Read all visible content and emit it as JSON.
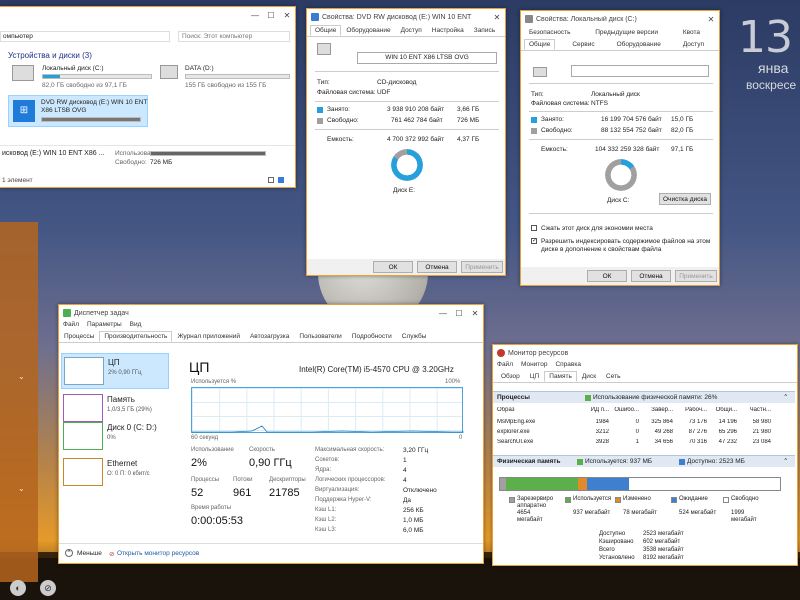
{
  "desktop": {
    "clock_day_num": "13",
    "clock_month": "янва",
    "clock_weekday": "воскресе"
  },
  "explorer": {
    "path_text": "омпьютер",
    "search_placeholder": "Поиск: Этот компьютер",
    "section_header": "Устройства и диски (3)",
    "drives": [
      {
        "name": "Локальный диск (C:)",
        "free": "82,0 ГБ свободно из 97,1 ГБ",
        "fill": 0.16
      },
      {
        "name": "DATA (D:)",
        "free": "155 ГБ свободно из 155 ГБ",
        "fill": 0.0
      },
      {
        "name": "DVD RW дисковод (E:) WIN 10 ENT",
        "name2": "X86 LTSB OVG",
        "fill": 1.0
      }
    ],
    "details_title": "исковод (E:) WIN 10 ENT X86 ...",
    "details_used_label": "Использовано:",
    "details_free_label": "Свободно:",
    "details_free_value": "726 МБ",
    "status": "1 элемент"
  },
  "dvd_props": {
    "title": "Свойства: DVD RW дисковод (E:) WIN 10 ENT X86 LTSB...",
    "tabs": [
      "Общие",
      "Оборудование",
      "Доступ",
      "Настройка",
      "Запись"
    ],
    "volume_name": "WIN 10 ENT X86 LTSB OVG",
    "type_label": "Тип:",
    "type_value": "CD-дисковод",
    "fs_label": "Файловая система:",
    "fs_value": "UDF",
    "used_label": "Занято:",
    "used_bytes": "3 938 910 208 байт",
    "used_human": "3,66 ГБ",
    "free_label": "Свободно:",
    "free_bytes": "761 462 784 байт",
    "free_human": "726 МБ",
    "cap_label": "Емкость:",
    "cap_bytes": "4 700 372 992 байт",
    "cap_human": "4,37 ГБ",
    "disk_label": "Диск E:",
    "ok": "ОК",
    "cancel": "Отмена",
    "apply": "Применить",
    "colors": {
      "used": "#26a0da",
      "free": "#a0a0a0"
    }
  },
  "c_props": {
    "title": "Свойства: Локальный диск (C:)",
    "tabs_row1": [
      "Безопасность",
      "Предыдущие версии",
      "Квота"
    ],
    "tabs_row2": [
      "Общие",
      "Сервис",
      "Оборудование",
      "Доступ"
    ],
    "type_label": "Тип:",
    "type_value": "Локальный диск",
    "fs_label": "Файловая система:",
    "fs_value": "NTFS",
    "used_label": "Занято:",
    "used_bytes": "16 199 704 576 байт",
    "used_human": "15,0 ГБ",
    "free_label": "Свободно:",
    "free_bytes": "88 132 554 752 байт",
    "free_human": "82,0 ГБ",
    "cap_label": "Емкость:",
    "cap_bytes": "104 332 259 328 байт",
    "cap_human": "97,1 ГБ",
    "disk_label": "Диск C:",
    "cleanup": "Очистка диска",
    "compress": "Сжать этот диск для экономии места",
    "index_line1": "Разрешить индексировать содержимое файлов на этом",
    "index_line2": "диске в дополнение к свойствам файла",
    "ok": "ОК",
    "cancel": "Отмена",
    "apply": "Применить"
  },
  "taskmgr": {
    "title": "Диспетчер задач",
    "menu": [
      "Файл",
      "Параметры",
      "Вид"
    ],
    "tabs": [
      "Процессы",
      "Производительность",
      "Журнал приложений",
      "Автозагрузка",
      "Пользователи",
      "Подробности",
      "Службы"
    ],
    "side": [
      {
        "name": "ЦП",
        "sub": "2% 0,90 ГГц"
      },
      {
        "name": "Память",
        "sub": "1,0/3,5 ГБ (29%)"
      },
      {
        "name": "Диск 0 (C: D:)",
        "sub": "0%"
      },
      {
        "name": "Ethernet",
        "sub": "О: 0 П: 0 кбит/с"
      }
    ],
    "header": "ЦП",
    "cpu_name": "Intel(R) Core(TM) i5-4570 CPU @ 3.20GHz",
    "usage_label": "Используется %",
    "pct_max": "100%",
    "time_left": "60 секунд",
    "time_right": "0",
    "usage_stat_label": "Использование",
    "usage_stat": "2%",
    "speed_label": "Скорость",
    "speed": "0,90 ГГц",
    "procs_label": "Процессы",
    "procs": "52",
    "threads_label": "Потоки",
    "threads": "961",
    "handles_label": "Дескрипторы",
    "handles": "21785",
    "uptime_label": "Время работы",
    "uptime": "0:00:05:53",
    "specs": [
      {
        "k": "Максимальная скорость:",
        "v": "3,20 ГГц"
      },
      {
        "k": "Сокетов:",
        "v": "1"
      },
      {
        "k": "Ядра:",
        "v": "4"
      },
      {
        "k": "Логических процессоров:",
        "v": "4"
      },
      {
        "k": "Виртуализация:",
        "v": "Отключено"
      },
      {
        "k": "Поддержка Hyper-V:",
        "v": "Да"
      },
      {
        "k": "Кэш L1:",
        "v": "256 КБ"
      },
      {
        "k": "Кэш L2:",
        "v": "1,0 МБ"
      },
      {
        "k": "Кэш L3:",
        "v": "6,0 МБ"
      }
    ],
    "less": "Меньше",
    "open_rm": "Открыть монитор ресурсов"
  },
  "resmon": {
    "title": "Монитор ресурсов",
    "menu": [
      "Файл",
      "Монитор",
      "Справка"
    ],
    "tabs": [
      "Обзор",
      "ЦП",
      "Память",
      "Диск",
      "Сеть"
    ],
    "procs_header": "Процессы",
    "procs_usage": "Использование физической памяти: 26%",
    "cols": [
      "Образ",
      "ИД п...",
      "Ошибо...",
      "Завер...",
      "Рабоч...",
      "Общи...",
      "Частн..."
    ],
    "rows": [
      [
        "MsMpEng.exe",
        "1984",
        "0",
        "325 864",
        "73 176",
        "14 196",
        "58 980"
      ],
      [
        "explorer.exe",
        "3212",
        "0",
        "49 268",
        "87 276",
        "65 296",
        "21 980"
      ],
      [
        "SearchUI.exe",
        "3928",
        "1",
        "34 656",
        "70 316",
        "47 232",
        "23 084"
      ]
    ],
    "phys_header": "Физическая память",
    "phys_used": "Используется: 937 МБ",
    "phys_avail": "Доступно: 2523 МБ",
    "legend": [
      {
        "name": "Зарезервиро аппаратно",
        "val": "4654",
        "unit": "мегабайт",
        "color": "#a0a0a0"
      },
      {
        "name": "Используется",
        "val": "937 мегабайт",
        "unit": "",
        "color": "#5bb04a"
      },
      {
        "name": "Изменено",
        "val": "78 мегабайт",
        "unit": "",
        "color": "#e08a2a"
      },
      {
        "name": "Ожидание",
        "val": "524 мегабайт",
        "unit": "",
        "color": "#3f7fd0"
      },
      {
        "name": "Свободно",
        "val": "1999",
        "unit": "мегабайт",
        "color": "#ffffff"
      }
    ],
    "summary": [
      {
        "k": "Доступно",
        "v": "2523 мегабайт"
      },
      {
        "k": "Кэшировано",
        "v": "602 мегабайт"
      },
      {
        "k": "Всего",
        "v": "3538 мегабайт"
      },
      {
        "k": "Установлено",
        "v": "8192 мегабайт"
      }
    ]
  }
}
